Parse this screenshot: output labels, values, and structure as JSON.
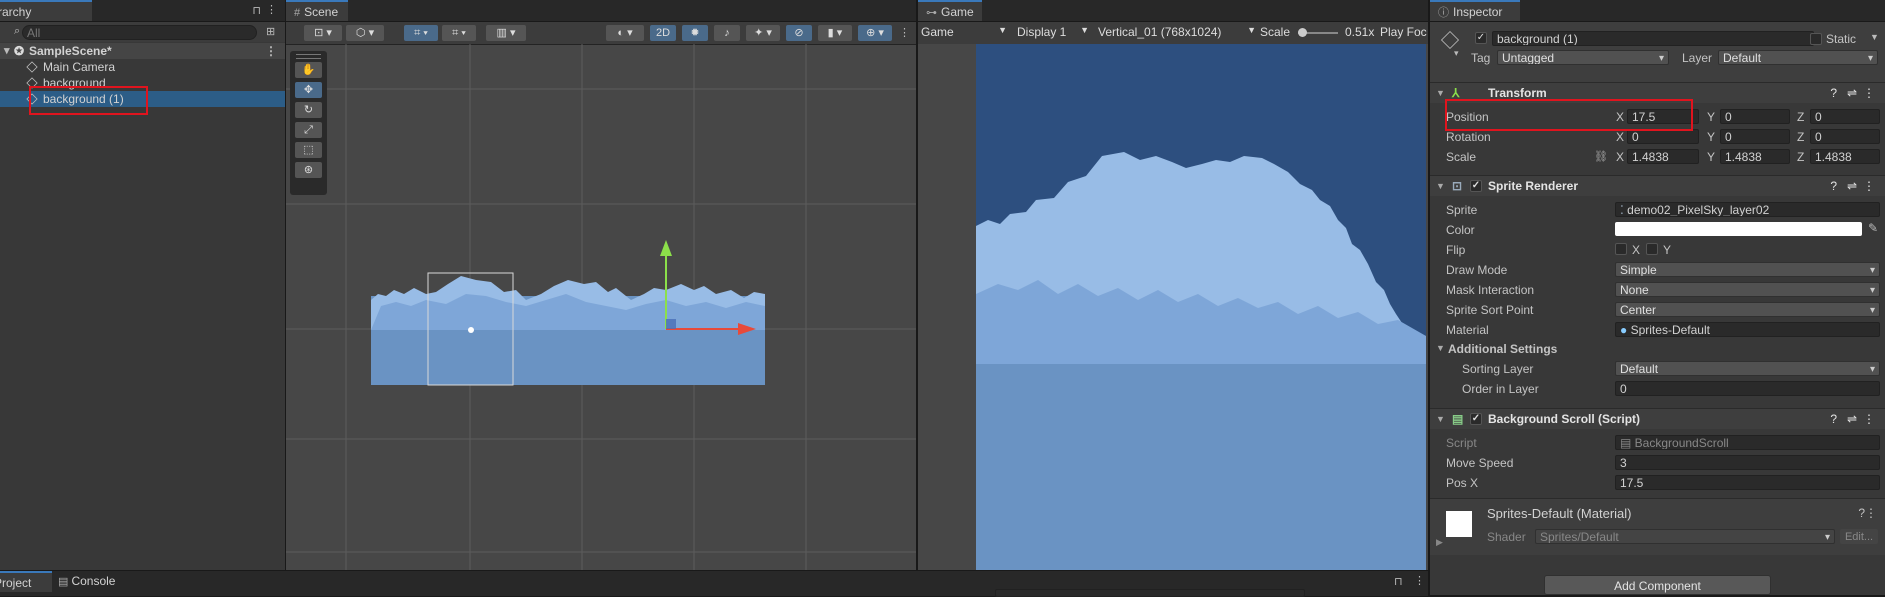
{
  "hierarchy": {
    "tab_label": "Hierarchy",
    "search_placeholder": "All",
    "scene_name": "SampleScene*",
    "items": [
      "Main Camera",
      "background",
      "background (1)"
    ]
  },
  "scene": {
    "tab_label": "Scene",
    "btn_2d": "2D"
  },
  "game": {
    "tab_label": "Game",
    "mode": "Game",
    "display": "Display 1",
    "resolution": "Vertical_01 (768x1024)",
    "scale_label": "Scale",
    "scale_value": "0.51x",
    "play_focused": "Play Foc"
  },
  "inspector": {
    "tab_label": "Inspector",
    "object_name": "background (1)",
    "static_label": "Static",
    "tag_label": "Tag",
    "tag_value": "Untagged",
    "layer_label": "Layer",
    "layer_value": "Default",
    "transform": {
      "title": "Transform",
      "position_label": "Position",
      "rotation_label": "Rotation",
      "scale_label": "Scale",
      "pos": {
        "x": "17.5",
        "y": "0",
        "z": "0"
      },
      "rot": {
        "x": "0",
        "y": "0",
        "z": "0"
      },
      "scl": {
        "x": "1.4838",
        "y": "1.4838",
        "z": "1.4838"
      },
      "x_label": "X",
      "y_label": "Y",
      "z_label": "Z"
    },
    "sprite_renderer": {
      "title": "Sprite Renderer",
      "sprite_label": "Sprite",
      "sprite_value": "demo02_PixelSky_layer02",
      "color_label": "Color",
      "flip_label": "Flip",
      "flip_x": "X",
      "flip_y": "Y",
      "draw_mode_label": "Draw Mode",
      "draw_mode_value": "Simple",
      "mask_label": "Mask Interaction",
      "mask_value": "None",
      "sort_point_label": "Sprite Sort Point",
      "sort_point_value": "Center",
      "material_label": "Material",
      "material_value": "Sprites-Default",
      "additional_label": "Additional Settings",
      "sorting_layer_label": "Sorting Layer",
      "sorting_layer_value": "Default",
      "order_label": "Order in Layer",
      "order_value": "0"
    },
    "background_scroll": {
      "title": "Background Scroll (Script)",
      "script_label": "Script",
      "script_value": "BackgroundScroll",
      "move_speed_label": "Move Speed",
      "move_speed_value": "3",
      "posx_label": "Pos X",
      "posx_value": "17.5"
    },
    "material": {
      "title": "Sprites-Default (Material)",
      "shader_label": "Shader",
      "shader_value": "Sprites/Default",
      "edit_label": "Edit..."
    },
    "add_component": "Add Component"
  },
  "bottom": {
    "project_tab": "Project",
    "console_tab": "Console"
  },
  "colors": {
    "selection": "#2c5d87",
    "highlight_red": "#e0141e",
    "sky_dark": "#2d4f7f",
    "sky_light": "#6a93c3"
  }
}
